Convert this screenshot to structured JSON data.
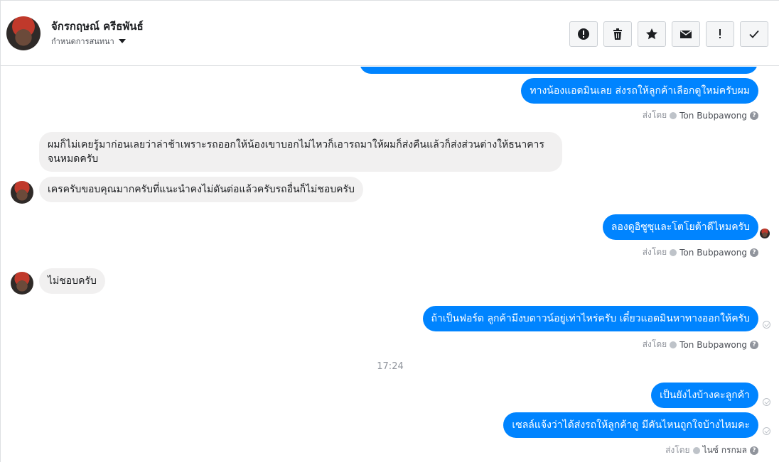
{
  "header": {
    "contact_name": "จักรกฤษณ์ ครีธพันธ์",
    "assign_label": "กำหนดการสนทนา",
    "toolbar": [
      {
        "name": "spam-button",
        "icon": "alert-circle-icon"
      },
      {
        "name": "delete-button",
        "icon": "trash-icon"
      },
      {
        "name": "star-button",
        "icon": "star-icon"
      },
      {
        "name": "mark-unread-button",
        "icon": "envelope-icon"
      },
      {
        "name": "follow-up-button",
        "icon": "exclamation-icon"
      },
      {
        "name": "done-button",
        "icon": "check-icon"
      }
    ]
  },
  "messages": {
    "m1": "ทางน้องแอดมินเลย ส่งรถให้ลูกค้าเลือกดูใหม่ครับผม",
    "m2": "ผมก็ไม่เคยรู้มาก่อนเลยว่าล่าช้าเพราะรถออกให้น้องเขาบอกไม่ไหวก็เอารถมาให้ผมก็ส่งคืนแล้วก็ส่งส่วนต่างให้ธนาคารจนหมดครับ",
    "m3": "เครครับขอบคุณมากครับที่แนะนำคงไม่ดันต่อแล้วครับรถอื่นก็ไม่ชอบครับ",
    "m4": "ลองดูอิซูซุและโตโยต้าดีไหมครับ",
    "m5": "ไม่ชอบครับ",
    "m6": "ถ้าเป็นฟอร์ด ลูกค้ามีงบดาวน์อยู่เท่าไหร่ครับ เดี๋ยวแอดมินหาทางออกให้ครับ",
    "m7": "เป็นยังไงบ้างคะลูกค้า",
    "m8": "เซลล์แจ้งว่าได้ส่งรถให้ลูกค้าดู  มีคันไหนถูกใจบ้างไหมคะ"
  },
  "sent_by_label": "ส่งโดย",
  "senders": {
    "ton": "Ton Bubpawong",
    "nine": "ไนซ์ กรกมล"
  },
  "timestamp": "17:24",
  "colors": {
    "outgoing_bubble": "#0084ff",
    "incoming_bubble": "#f1f0f0",
    "meta_text": "#90949c"
  }
}
